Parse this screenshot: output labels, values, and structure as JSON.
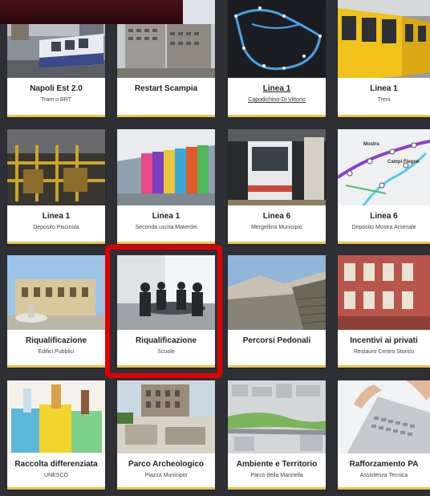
{
  "cards": [
    {
      "title": "Napoli Est 2.0",
      "subtitle": "Tram o BRT"
    },
    {
      "title": "Restart Scampia",
      "subtitle": ""
    },
    {
      "title": "Linea 1",
      "subtitle": "Capodichino-Di Vittorio"
    },
    {
      "title": "Linea 1",
      "subtitle": "Treni"
    },
    {
      "title": "Linea 1",
      "subtitle": "Deposito Piscinola"
    },
    {
      "title": "Linea 1",
      "subtitle": "Seconda uscita Materdei"
    },
    {
      "title": "Linea 6",
      "subtitle": "Mergellina Municipio"
    },
    {
      "title": "Linea 6",
      "subtitle": "Deposito Mostra Arsenale"
    },
    {
      "title": "Riqualificazione",
      "subtitle": "Edifici Pubblici"
    },
    {
      "title": "Riqualificazione",
      "subtitle": "Scuole"
    },
    {
      "title": "Percorsi Pedonali",
      "subtitle": ""
    },
    {
      "title": "Incentivi ai privati",
      "subtitle": "Restauro Centro Storico"
    },
    {
      "title": "Raccolta differenziata",
      "subtitle": "UNESCO"
    },
    {
      "title": "Parco Archeologico",
      "subtitle": "Piazza Municipio"
    },
    {
      "title": "Ambiente e Territorio",
      "subtitle": "Parco della Marinella"
    },
    {
      "title": "Rafforzamento PA",
      "subtitle": "Assistenza Tecnica"
    }
  ],
  "map_labels": {
    "mostra": "Mostra",
    "campi": "Campi Flegrei"
  },
  "colors": {
    "accent": "#e7c64f",
    "highlight": "#e00000",
    "background": "#2e3035"
  }
}
